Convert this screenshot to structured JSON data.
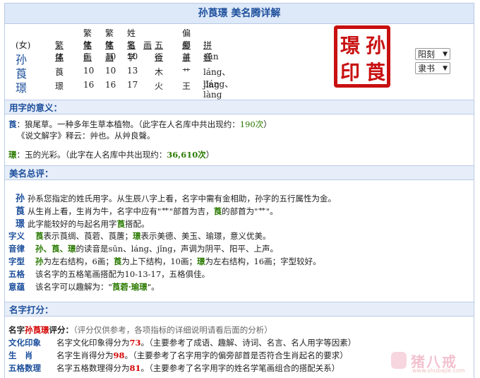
{
  "title": "孙莨璟  美名腾详解",
  "charsTable": {
    "headTop": [
      "繁体",
      "繁体",
      "姓名学",
      "偏旁"
    ],
    "head": [
      "(女)",
      "繁体",
      "笔画",
      "笔画",
      "笔",
      "画",
      "五行",
      "部首",
      "拼音"
    ],
    "rows": [
      {
        "char": "孙",
        "trad": "孫",
        "s1": "6",
        "s2": "10",
        "s3": "10",
        "wx": "金",
        "bs": "子",
        "py": "sūn"
      },
      {
        "char": "莨",
        "trad": "莨",
        "s1": "10",
        "s2": "10",
        "s3": "13",
        "wx": "木",
        "bs": "艹",
        "py": "láng、liáng、làng"
      },
      {
        "char": "璟",
        "trad": "璟",
        "s1": "16",
        "s2": "16",
        "s3": "17",
        "wx": "火",
        "bs": "王",
        "py": "jǐng"
      }
    ]
  },
  "seal": {
    "chars": [
      "孙",
      "莨",
      "璟",
      "印"
    ]
  },
  "selects": {
    "style": "阳刻",
    "font": "隶书"
  },
  "meaning": {
    "header": "用字的意义：",
    "c1_char": "莨",
    "c1_text": "：狼尾草。一种多年生草本植物。（此字在人名库中共出现约：",
    "c1_count": "190次",
    "c1_tail": "）",
    "c1_line2": "《说文解字》释云：艸也。从艸良聲。",
    "c2_char": "璟",
    "c2_text": "：玉的光彩。（此字在人名库中共出现约：",
    "c2_count": "36,610次",
    "c2_tail": "）"
  },
  "summary": {
    "header": "美名总评：",
    "l1_char": "孙",
    "l1_text": "孙系您指定的姓氏用字。从生辰八字上看，名字中需有金相助，孙字的五行属性为金。",
    "l2_char": "莨",
    "l2_a": "从生肖上看，生肖为牛，名字中应有\"艹\"部首为吉，",
    "l2_hl": "莨",
    "l2_b": "的部首为\"艹\"。",
    "l3_char": "璟",
    "l3_a": "此字能较好的与起名用字",
    "l3_hl": "莨",
    "l3_b": "搭配。",
    "ziyi_lbl": "字义",
    "ziyi_c1": "莨",
    "ziyi_a": "表示莨绸、莨菪、莨蓎；",
    "ziyi_c2": "璟",
    "ziyi_b": "表示美德、美玉、瑜璟，意义优美。",
    "yinlv_lbl": "音律",
    "yinlv_hl": "孙、莨、璟",
    "yinlv_a": "的读音是sūn、láng、jǐng，声调为阴平、阳平、上声。",
    "zixing_lbl": "字型",
    "zx_c1": "孙",
    "zx_a": "为左右结构，6画；",
    "zx_c2": "莨",
    "zx_b": "为上下结构，10画；",
    "zx_c3": "璟",
    "zx_c": "为左右结构，16画；字型较好。",
    "wuge_lbl": "五格",
    "wuge_text": "该名字的五格笔画搭配为10-13-17，五格俱佳。",
    "yiyun_lbl": "意蕴",
    "yiyun_a": "该名字可以趣解为：\"",
    "yiyun_hl": "莨菪·瑜璟",
    "yiyun_b": "\"。"
  },
  "score": {
    "header": "名字打分：",
    "intro_a": "名字",
    "intro_name": "孙莨璟",
    "intro_b": "评分：",
    "intro_note": "（评分仅供参考，各项指标的详细说明请看后面的分析）",
    "rows": [
      {
        "label": "文化印象",
        "text": "名字文化印象得分为",
        "val": "73",
        "note": "。（主要参考了成语、趣解、诗词、名言、名人用字等因素）"
      },
      {
        "label": "生　肖",
        "text": "名字生肖得分为",
        "val": "98",
        "note": "。（主要参考了名字用字的偏旁部首是否符合生肖起名的要求）"
      },
      {
        "label": "五格数理",
        "text": "名字五格数理得分为",
        "val": "81",
        "note": "。（主要参考了名字用字的姓名学笔画组合的搭配关系）"
      }
    ]
  },
  "watermark": {
    "site": "猪八戒",
    "url": "www.shubajie.com"
  }
}
